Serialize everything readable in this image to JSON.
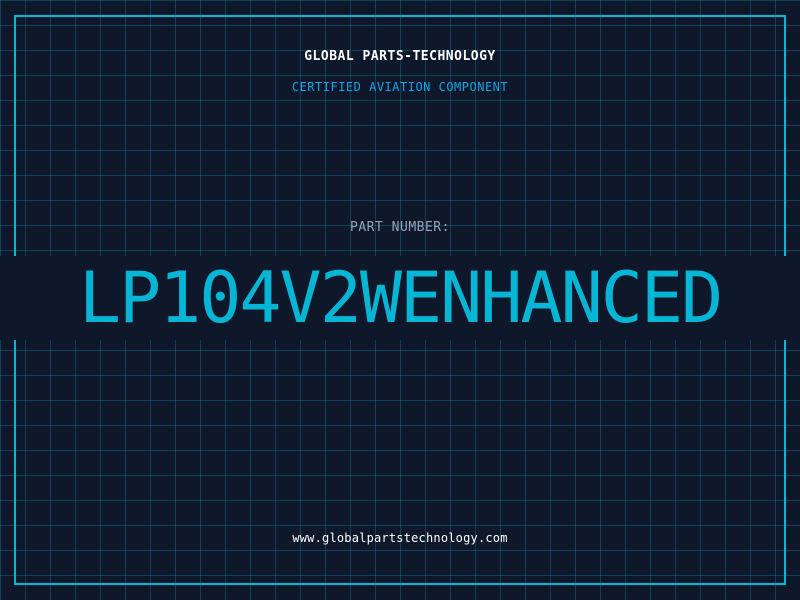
{
  "header": {
    "brand": "GLOBAL PARTS-TECHNOLOGY",
    "subtitle": "CERTIFIED AVIATION COMPONENT"
  },
  "main": {
    "label": "PART NUMBER:",
    "part_number": "LP104V2WENHANCED"
  },
  "footer": {
    "url": "www.globalpartstechnology.com"
  },
  "colors": {
    "background": "#0f172a",
    "accent": "#06b6d4",
    "grid": "#0e7490"
  }
}
